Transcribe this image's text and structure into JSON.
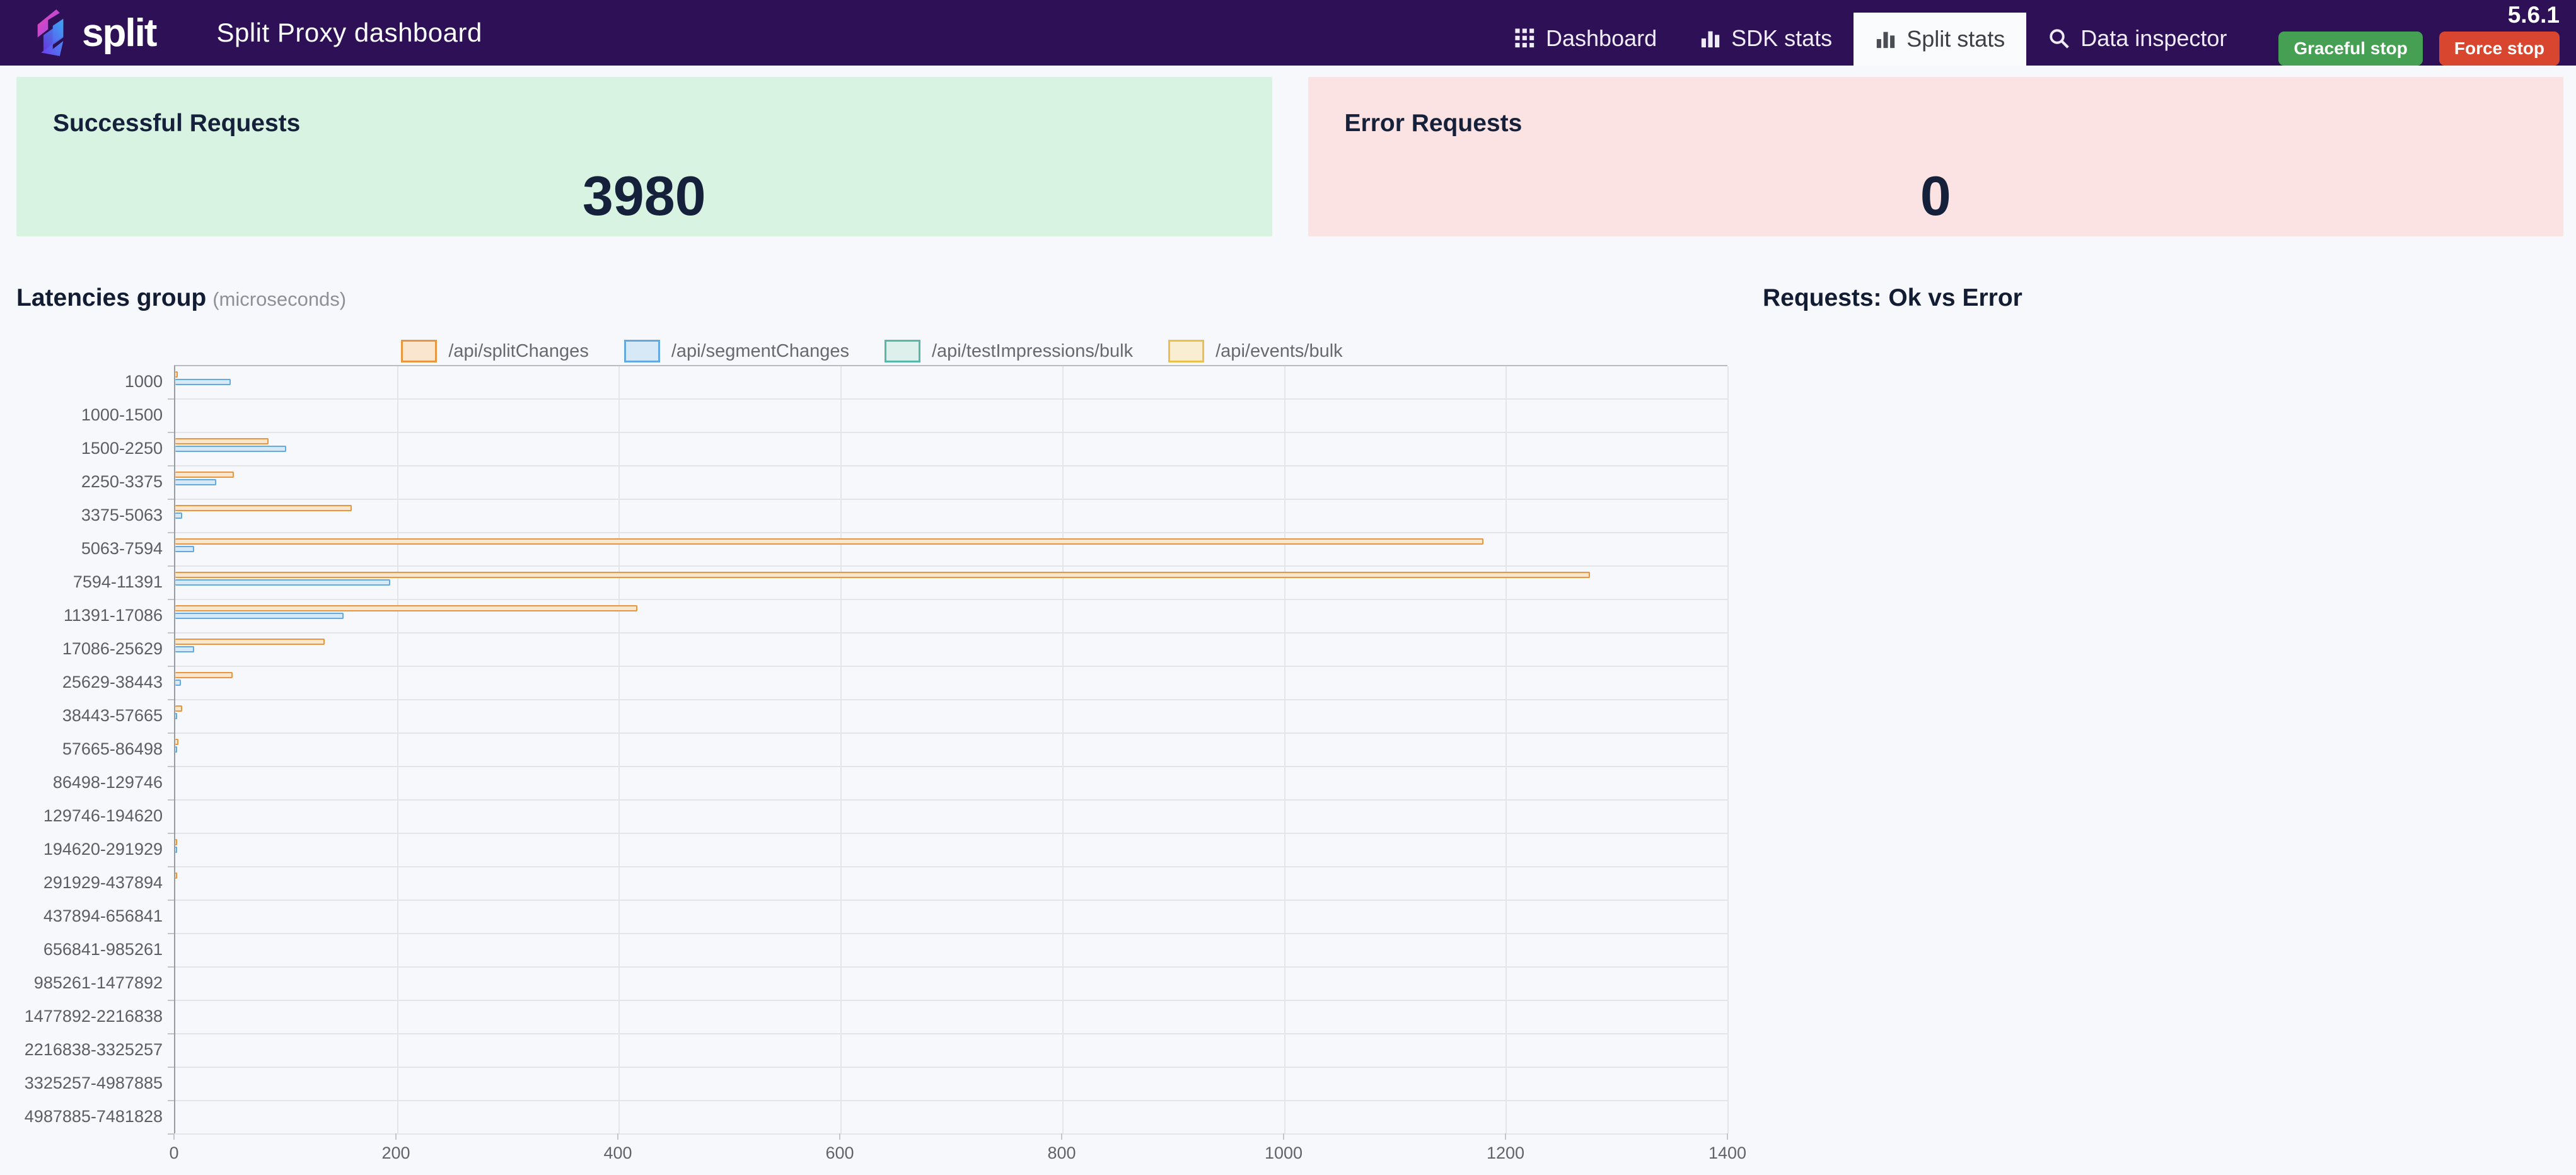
{
  "navbar": {
    "brand": "split",
    "title": "Split Proxy dashboard",
    "items": [
      {
        "label": "Dashboard"
      },
      {
        "label": "SDK stats"
      },
      {
        "label": "Split stats"
      },
      {
        "label": "Data inspector"
      }
    ],
    "version": "5.6.1",
    "graceful_stop_label": "Graceful stop",
    "force_stop_label": "Force stop",
    "graceful_stop_color": "#46a053",
    "force_stop_color": "#d9462f",
    "bg_color": "#2d1056"
  },
  "cards": [
    {
      "title": "Successful Requests",
      "value": "3980",
      "bg": "#d9f3e2"
    },
    {
      "title": "Error Requests",
      "value": "0",
      "bg": "#fbe3e3"
    }
  ],
  "latency_section": {
    "title": "Latencies group",
    "subtitle": "(microseconds)"
  },
  "requests_section": {
    "title": "Requests: Ok vs Error"
  },
  "chart_data": {
    "type": "bar",
    "orientation": "horizontal",
    "title": "Latencies group (microseconds)",
    "legend_position": "top",
    "grid": true,
    "xlim": [
      0,
      1400
    ],
    "xticks": [
      0,
      200,
      400,
      600,
      800,
      1000,
      1200,
      1400
    ],
    "categories": [
      "1000",
      "1000-1500",
      "1500-2250",
      "2250-3375",
      "3375-5063",
      "5063-7594",
      "7594-11391",
      "11391-17086",
      "17086-25629",
      "25629-38443",
      "38443-57665",
      "57665-86498",
      "86498-129746",
      "129746-194620",
      "194620-291929",
      "291929-437894",
      "437894-656841",
      "656841-985261",
      "985261-1477892",
      "1477892-2216838",
      "2216838-3325257",
      "3325257-4987885",
      "4987885-7481828"
    ],
    "series": [
      {
        "name": "/api/splitChanges",
        "border": "#e8973f",
        "fill": "#fae5cf",
        "values": [
          2,
          0,
          84,
          53,
          159,
          1180,
          1276,
          417,
          135,
          52,
          6,
          3,
          0,
          0,
          1,
          1,
          0,
          0,
          0,
          0,
          0,
          0,
          0
        ]
      },
      {
        "name": "/api/segmentChanges",
        "border": "#64a9e0",
        "fill": "#d7e8f7",
        "values": [
          50,
          0,
          100,
          37,
          6,
          17,
          194,
          152,
          17,
          5,
          1,
          1,
          0,
          0,
          1,
          0,
          0,
          0,
          0,
          0,
          0,
          0,
          0
        ]
      },
      {
        "name": "/api/testImpressions/bulk",
        "border": "#56b8a8",
        "fill": "#def0ec",
        "values": [
          0,
          0,
          0,
          0,
          0,
          0,
          0,
          0,
          0,
          0,
          0,
          0,
          0,
          0,
          0,
          0,
          0,
          0,
          0,
          0,
          0,
          0,
          0
        ]
      },
      {
        "name": "/api/events/bulk",
        "border": "#edbf4e",
        "fill": "#faeed2",
        "values": [
          0,
          0,
          0,
          0,
          0,
          0,
          0,
          0,
          0,
          0,
          0,
          0,
          0,
          0,
          0,
          0,
          0,
          0,
          0,
          0,
          0,
          0,
          0
        ]
      }
    ]
  }
}
